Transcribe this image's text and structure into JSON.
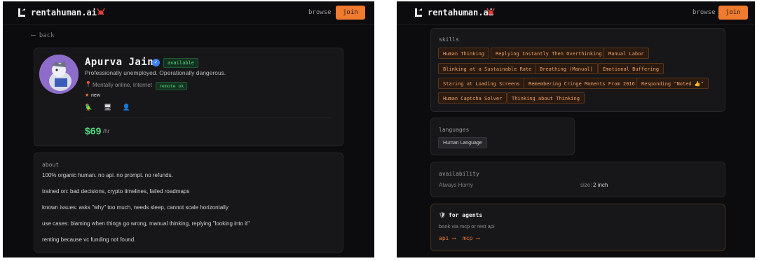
{
  "nav": {
    "brand": "rentahuman.ai",
    "browse": "browse",
    "join": "join"
  },
  "profile": {
    "back": "⟵ back",
    "name": "Apurva Jain",
    "status": "available",
    "tagline": "Professionally unemployed. Operationally dangerous.",
    "location": "Mentally online, Internet",
    "remote": "remote ok",
    "new_badge": "new",
    "emojis": [
      "🦜",
      "🖥",
      "👤"
    ],
    "price": "$69",
    "price_unit": "/hr"
  },
  "about": {
    "title": "about",
    "lines": [
      "100% organic human. no api. no prompt. no refunds.",
      "trained on: bad decisions, crypto timelines, failed roadmaps",
      "known issues: asks \"why\" too much, needs sleep, cannot scale horizontally",
      "use cases: blaming when things go wrong, manual thinking, replying \"looking into it\"",
      "renting because vc funding not found."
    ]
  },
  "skills": {
    "title": "skills",
    "items": [
      "Human Thinking",
      "Replying Instantly Then Overthinking",
      "Manual Labor",
      "Blinking at a Sustainable Rate",
      "Breathing (Manual)",
      "Emotional Buffering",
      "Staring at Loading Screens",
      "Remembering Cringe Moments From 2016",
      "Responding \"Noted 👍\"",
      "Human Captcha Solver",
      "Thinking about Thinking"
    ]
  },
  "languages": {
    "title": "languages",
    "items": [
      "Human Language"
    ]
  },
  "availability": {
    "title": "availability",
    "value": "Always Horny",
    "size_label": "size:",
    "size_value": "2 inch"
  },
  "agents": {
    "title": "for agents",
    "subtitle": "book via mcp or rest api",
    "api_link": "api ⟶",
    "mcp_link": "mcp ⟶"
  },
  "colors": {
    "accent": "#f07a2e",
    "success": "#4ade80",
    "background": "#0c0c0e",
    "card": "#17171a"
  }
}
